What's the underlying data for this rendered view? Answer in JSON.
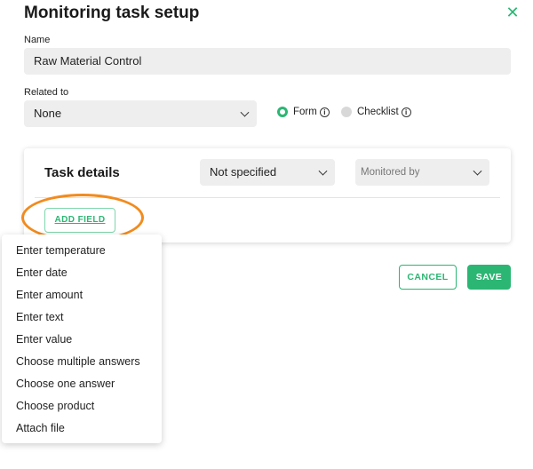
{
  "dialog": {
    "title": "Monitoring task setup",
    "close_icon": "close-icon"
  },
  "name": {
    "label": "Name",
    "value": "Raw Material Control"
  },
  "related": {
    "label": "Related to",
    "value": "None",
    "options": [
      {
        "label": "Form",
        "selected": true
      },
      {
        "label": "Checklist",
        "selected": false
      }
    ],
    "info_icon_glyph": "i"
  },
  "task_details": {
    "title": "Task details",
    "status_value": "Not specified",
    "monitored_placeholder": "Monitored by",
    "add_field_label": "ADD FIELD"
  },
  "actions": {
    "cancel_label": "CANCEL",
    "save_label": "SAVE"
  },
  "field_menu": {
    "items": [
      "Enter temperature",
      "Enter date",
      "Enter amount",
      "Enter text",
      "Enter value",
      "Choose multiple answers",
      "Choose one answer",
      "Choose product",
      "Attach file"
    ]
  },
  "colors": {
    "accent": "#2bb673",
    "highlight": "#f28b1e",
    "field_bg": "#eeeeee"
  }
}
